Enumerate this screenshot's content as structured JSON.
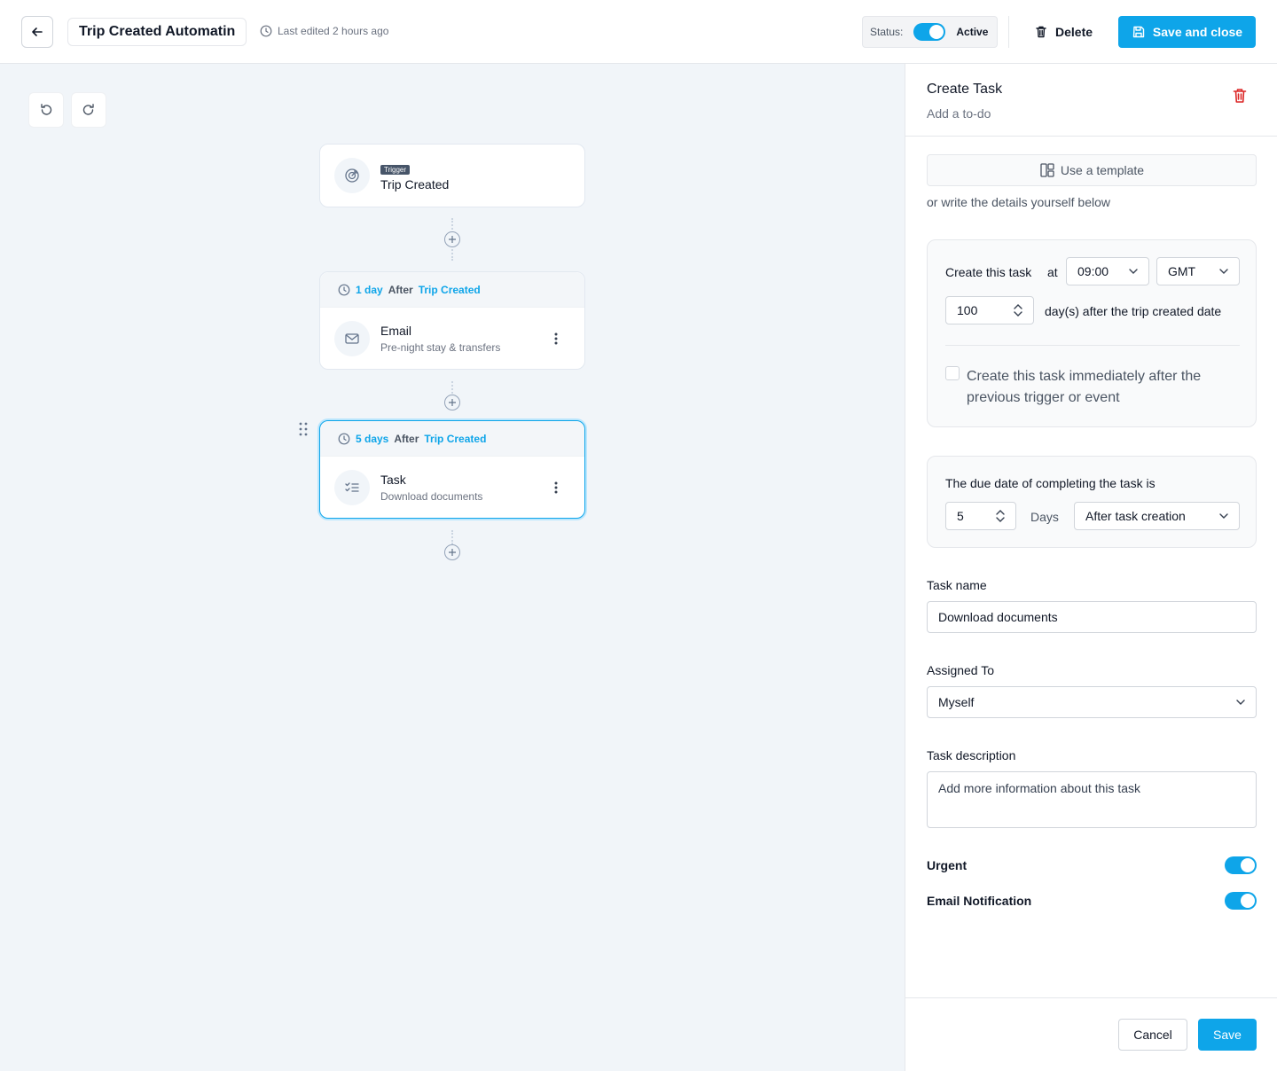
{
  "header": {
    "title": "Trip Created Automatin",
    "last_edited": "Last edited 2 hours ago",
    "status_label": "Status:",
    "status_value": "Active",
    "delete_label": "Delete",
    "save_close_label": "Save and close"
  },
  "workflow": {
    "trigger": {
      "badge": "Trigger",
      "title": "Trip Created"
    },
    "steps": [
      {
        "delay": "1 day",
        "after": "After",
        "event": "Trip Created",
        "title": "Email",
        "subtitle": "Pre-night stay & transfers",
        "icon": "mail-icon"
      },
      {
        "delay": "5 days",
        "after": "After",
        "event": "Trip Created",
        "title": "Task",
        "subtitle": "Download documents",
        "icon": "checklist-icon"
      }
    ]
  },
  "panel": {
    "title": "Create Task",
    "subtitle": "Add a to-do",
    "template_button": "Use a template",
    "template_hint": "or write the details yourself below",
    "schedule": {
      "create_label": "Create this task",
      "at_label": "at",
      "time": "09:00",
      "timezone": "GMT",
      "days": "100",
      "days_suffix": "day(s) after the trip created date",
      "immediate_label": "Create this task immediately after the previous trigger or event"
    },
    "due": {
      "label": "The due date of completing the task is",
      "value": "5",
      "unit": "Days",
      "relative": "After task creation"
    },
    "task_name": {
      "label": "Task name",
      "value": "Download documents"
    },
    "assigned_to": {
      "label": "Assigned To",
      "value": "Myself"
    },
    "description": {
      "label": "Task description",
      "placeholder": "Add more information about this task"
    },
    "urgent": {
      "label": "Urgent",
      "on": true
    },
    "email_notification": {
      "label": "Email Notification",
      "on": true
    },
    "cancel_label": "Cancel",
    "save_label": "Save"
  },
  "colors": {
    "accent": "#0ea5e9",
    "danger": "#dc2626",
    "canvas": "#f1f5f9"
  }
}
